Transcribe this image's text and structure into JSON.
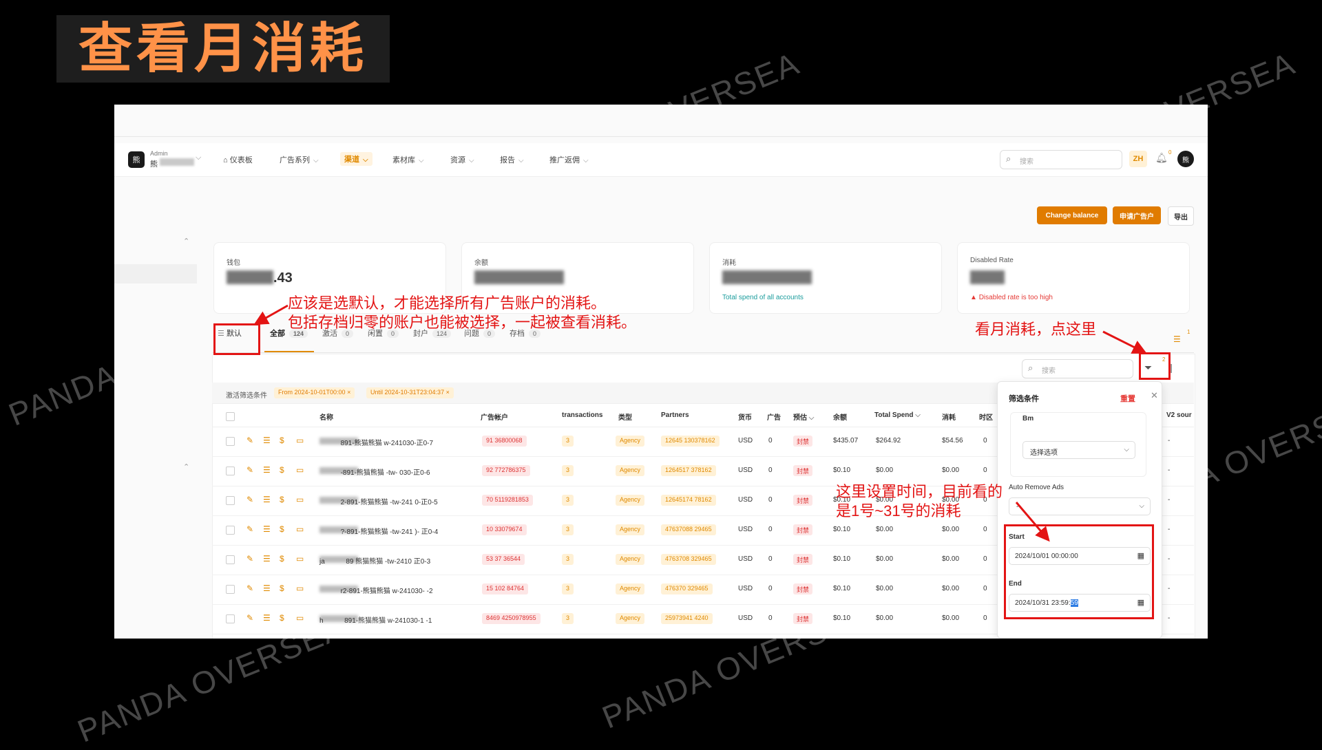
{
  "title": "查看月消耗",
  "watermark": "PANDA OVERSEA",
  "nav": {
    "role": "Admin",
    "name": "熊",
    "items": [
      {
        "label": "仪表板",
        "active": false
      },
      {
        "label": "广告系列",
        "active": false
      },
      {
        "label": "渠道",
        "active": true
      },
      {
        "label": "素材库",
        "active": false
      },
      {
        "label": "资源",
        "active": false
      },
      {
        "label": "报告",
        "active": false
      },
      {
        "label": "推广返佣",
        "active": false
      }
    ],
    "search_placeholder": "搜索",
    "lang": "ZH",
    "notif_count": "0"
  },
  "actions": {
    "change_balance": "Change balance",
    "apply_account": "申请广告户",
    "export": "导出"
  },
  "cards": [
    {
      "label": "钱包",
      "value": ".43"
    },
    {
      "label": "余额",
      "value": ""
    },
    {
      "label": "消耗",
      "value": "",
      "sub": "Total spend of all accounts"
    },
    {
      "label": "Disabled Rate",
      "value": "",
      "warning": "Disabled rate is too high"
    }
  ],
  "tabs": {
    "default_label": "默认",
    "items": [
      {
        "label": "全部",
        "count": "124",
        "active": true
      },
      {
        "label": "激活",
        "count": "0"
      },
      {
        "label": "闲置",
        "count": "0"
      },
      {
        "label": "封户",
        "count": "124"
      },
      {
        "label": "问题",
        "count": "0"
      },
      {
        "label": "存档",
        "count": "0"
      }
    ],
    "right_badge": "1"
  },
  "table_search_placeholder": "搜索",
  "filter_badge": "2",
  "conditions": {
    "label": "激活筛选条件",
    "chips": [
      "From 2024-10-01T00:00",
      "Until 2024-10-31T23:04:37"
    ]
  },
  "table": {
    "columns": [
      "名称",
      "广告帐户",
      "transactions",
      "类型",
      "Partners",
      "货币",
      "广告",
      "预估",
      "余额",
      "Total Spend",
      "消耗",
      "时区",
      "V2 sour"
    ],
    "rows": [
      {
        "name_prefix": "",
        "name": "891-熊猫熊猫",
        "name_suffix": "w-241030-正0-7",
        "account": "91    36800068",
        "tx": "3",
        "type": "Agency",
        "partner": "12645    130378162",
        "currency": "USD",
        "ads": "0",
        "status": "封禁",
        "balance": "$435.07",
        "total": "$264.92",
        "spend": "$54.56",
        "tz": "0",
        "v2": "-"
      },
      {
        "name_prefix": "",
        "name": "-891-熊猫熊猫",
        "name_suffix": "-tw-   030-正0-6",
        "account": "92    772786375",
        "tx": "3",
        "type": "Agency",
        "partner": "1264517   378162",
        "currency": "USD",
        "ads": "0",
        "status": "封禁",
        "balance": "$0.10",
        "total": "$0.00",
        "spend": "$0.00",
        "tz": "0",
        "v2": "-"
      },
      {
        "name_prefix": "",
        "name": "2-891-熊猫熊猫",
        "name_suffix": "-tw-241   0-正0-5",
        "account": "70    5119281853",
        "tx": "3",
        "type": "Agency",
        "partner": "12645174   78162",
        "currency": "USD",
        "ads": "0",
        "status": "封禁",
        "balance": "$0.10",
        "total": "$0.00",
        "spend": "$0.00",
        "tz": "0",
        "v2": "-"
      },
      {
        "name_prefix": "",
        "name": "?-891-熊猫熊猫",
        "name_suffix": "-tw-241   )- 正0-4",
        "account": "10    33079674",
        "tx": "3",
        "type": "Agency",
        "partner": "47637088   29465",
        "currency": "USD",
        "ads": "0",
        "status": "封禁",
        "balance": "$0.10",
        "total": "$0.00",
        "spend": "$0.00",
        "tz": "0",
        "v2": "-"
      },
      {
        "name_prefix": "ja",
        "name": "89  熊猫熊猫",
        "name_suffix": "-tw-2410   正0-3",
        "account": "53    37   36544",
        "tx": "3",
        "type": "Agency",
        "partner": "4763708   329465",
        "currency": "USD",
        "ads": "0",
        "status": "封禁",
        "balance": "$0.10",
        "total": "$0.00",
        "spend": "$0.00",
        "tz": "0",
        "v2": "-"
      },
      {
        "name_prefix": "",
        "name": "r2-891-熊猫熊猫",
        "name_suffix": "w-241030-   -2",
        "account": "15    102   84764",
        "tx": "3",
        "type": "Agency",
        "partner": "476370   329465",
        "currency": "USD",
        "ads": "0",
        "status": "封禁",
        "balance": "$0.10",
        "total": "$0.00",
        "spend": "$0.00",
        "tz": "0",
        "v2": "-"
      },
      {
        "name_prefix": "h",
        "name": "891-熊猫熊猫",
        "name_suffix": "w-241030-1   -1",
        "account": "8469   4250978955",
        "tx": "3",
        "type": "Agency",
        "partner": "25973941   4240",
        "currency": "USD",
        "ads": "0",
        "status": "封禁",
        "balance": "$0.10",
        "total": "$0.00",
        "spend": "$0.00",
        "tz": "0",
        "v2": "-"
      }
    ]
  },
  "filter_panel": {
    "title": "筛选条件",
    "reset": "重置",
    "bm_label": "Bm",
    "bm_placeholder": "选择选项",
    "auto_remove_label": "Auto Remove Ads",
    "auto_remove_value": "-",
    "start_label": "Start",
    "start_value": "2024/10/01 00:00:00",
    "end_label": "End",
    "end_value": "2024/10/31 23:59:",
    "end_seconds": "59"
  },
  "annotations": {
    "default_note_1": "应该是选默认，才能选择所有广告账户的消耗。",
    "default_note_2": "包括存档归零的账户也能被选择，一起被查看消耗。",
    "filter_note": "看月消耗，点这里",
    "time_note_1": "这里设置时间，目前看的",
    "time_note_2": "是1号~31号的消耗"
  },
  "colors": {
    "accent": "#e07b00",
    "annotation": "#e31414",
    "title": "#ff9248"
  }
}
